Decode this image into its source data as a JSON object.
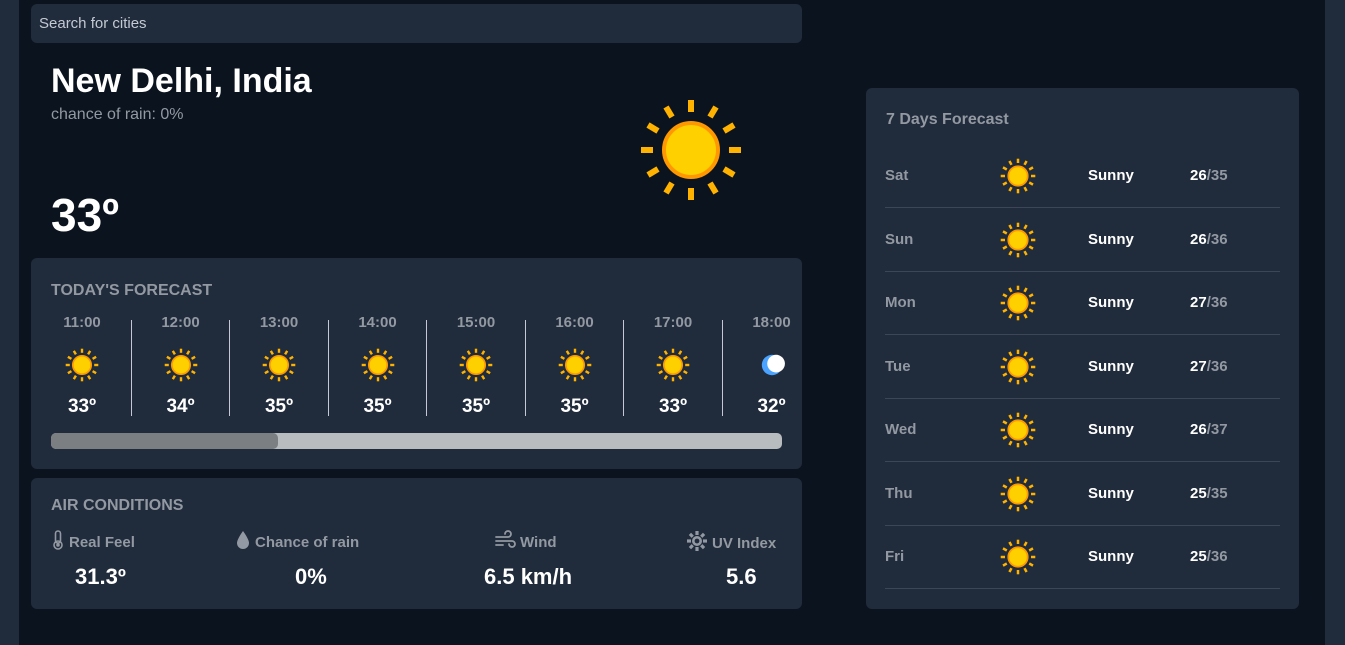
{
  "search": {
    "placeholder": "Search for cities"
  },
  "current": {
    "city": "New Delhi, India",
    "chance_of_rain": "chance of rain: 0%",
    "temperature": "33º",
    "icon": "sun-icon"
  },
  "today": {
    "title": "TODAY'S FORECAST",
    "hours": [
      {
        "time": "11:00",
        "temp": "33º",
        "icon": "sun-icon"
      },
      {
        "time": "12:00",
        "temp": "34º",
        "icon": "sun-icon"
      },
      {
        "time": "13:00",
        "temp": "35º",
        "icon": "sun-icon"
      },
      {
        "time": "14:00",
        "temp": "35º",
        "icon": "sun-icon"
      },
      {
        "time": "15:00",
        "temp": "35º",
        "icon": "sun-icon"
      },
      {
        "time": "16:00",
        "temp": "35º",
        "icon": "sun-icon"
      },
      {
        "time": "17:00",
        "temp": "33º",
        "icon": "sun-icon"
      },
      {
        "time": "18:00",
        "temp": "32º",
        "icon": "moon-icon"
      }
    ],
    "scroll_position": 0.31
  },
  "air": {
    "title": "AIR CONDITIONS",
    "real_feel": {
      "label": "Real Feel",
      "value": "31.3º",
      "icon": "thermometer-icon"
    },
    "chance_of_rain": {
      "label": "Chance of rain",
      "value": "0%",
      "icon": "droplet-icon"
    },
    "wind": {
      "label": "Wind",
      "value": "6.5 km/h",
      "icon": "wind-icon"
    },
    "uv_index": {
      "label": "UV Index",
      "value": "5.6",
      "icon": "sun-gear-icon"
    }
  },
  "week": {
    "title": "7 Days Forecast",
    "days": [
      {
        "day": "Sat",
        "condition": "Sunny",
        "high": "26",
        "low": "35",
        "sep": "/",
        "icon": "sun-icon"
      },
      {
        "day": "Sun",
        "condition": "Sunny",
        "high": "26",
        "low": "36",
        "sep": "/",
        "icon": "sun-icon"
      },
      {
        "day": "Mon",
        "condition": "Sunny",
        "high": "27",
        "low": "36",
        "sep": "/",
        "icon": "sun-icon"
      },
      {
        "day": "Tue",
        "condition": "Sunny",
        "high": "27",
        "low": "36",
        "sep": "/",
        "icon": "sun-icon"
      },
      {
        "day": "Wed",
        "condition": "Sunny",
        "high": "26",
        "low": "37",
        "sep": "/",
        "icon": "sun-icon"
      },
      {
        "day": "Thu",
        "condition": "Sunny",
        "high": "25",
        "low": "35",
        "sep": "/",
        "icon": "sun-icon"
      },
      {
        "day": "Fri",
        "condition": "Sunny",
        "high": "25",
        "low": "36",
        "sep": "/",
        "icon": "sun-icon"
      }
    ]
  },
  "colors": {
    "background": "#0b131e",
    "panel": "#202b3b",
    "muted_text": "#9399a2",
    "sun": "#ffc700"
  }
}
